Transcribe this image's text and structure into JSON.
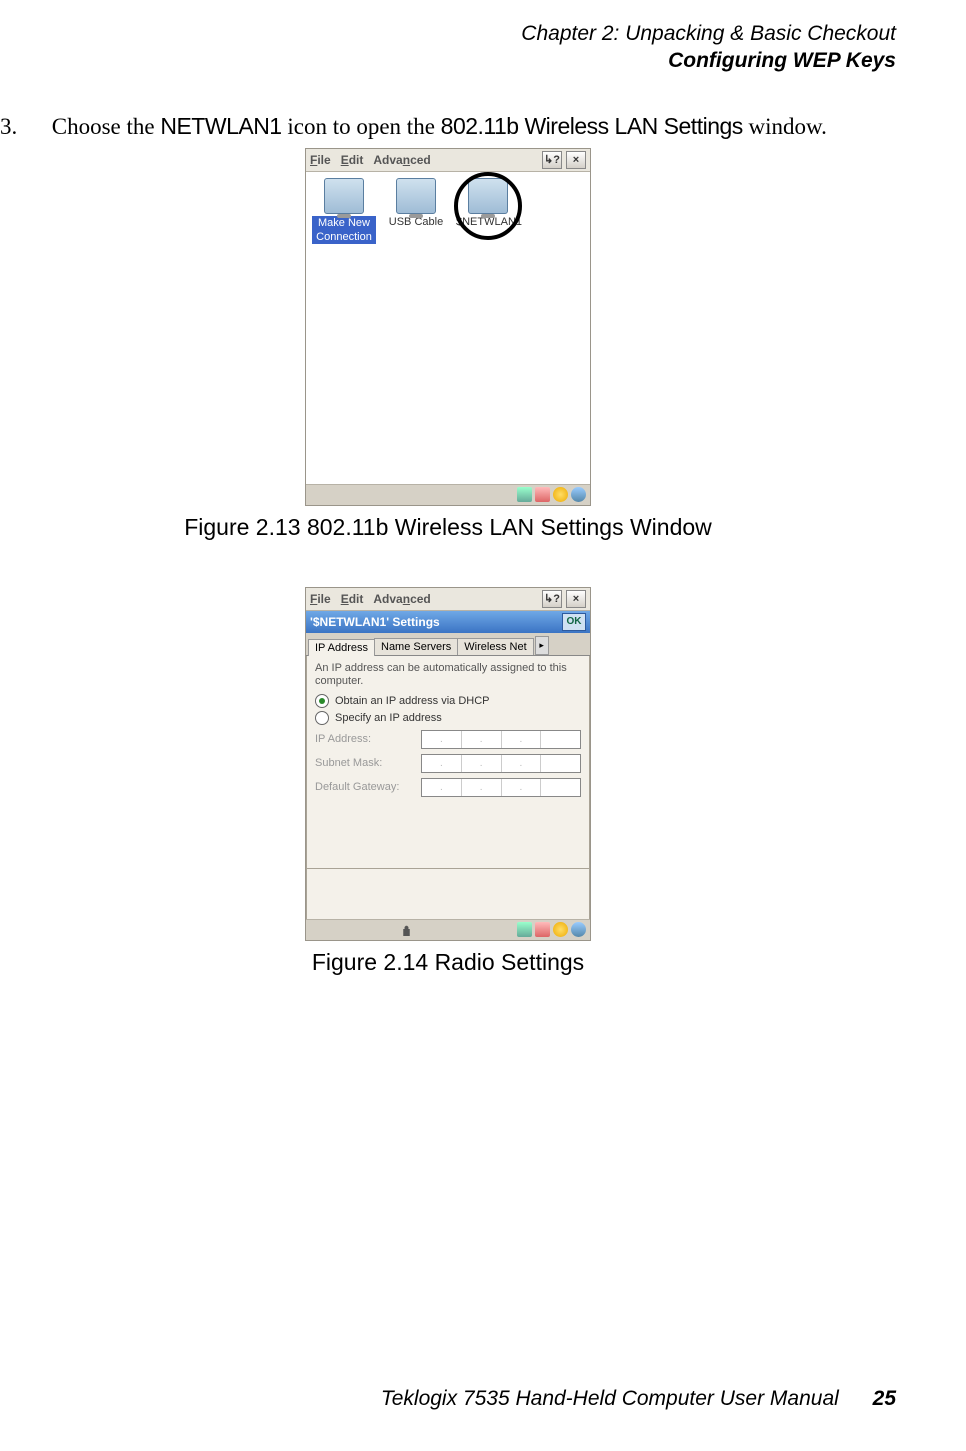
{
  "header": {
    "chapter": "Chapter  2:  Unpacking & Basic Checkout",
    "section": "Configuring WEP Keys"
  },
  "step": {
    "num": "3.",
    "pre": "Choose the ",
    "kw1": "NETWLAN1",
    "mid": " icon to open the ",
    "kw2": "802.11b Wireless LAN Settings",
    "post": " window."
  },
  "fig1": {
    "menu": {
      "file": "File",
      "file_u": "F",
      "edit": "Edit",
      "edit_u": "E",
      "advanced": "Advanced",
      "adv_u": "n",
      "help": "?",
      "close": "×"
    },
    "icons": {
      "makenew1": "Make New",
      "makenew2": "Connection",
      "usb": "USB Cable",
      "netwlan": "$NETWLAN1"
    },
    "caption": "Figure 2.13 802.11b Wireless LAN Settings Window"
  },
  "fig2": {
    "menu": {
      "file": "File",
      "file_u": "F",
      "edit": "Edit",
      "edit_u": "E",
      "advanced": "Advanced",
      "adv_u": "n",
      "help": "?",
      "close": "×"
    },
    "title": "'$NETWLAN1' Settings",
    "ok": "OK",
    "tabs": {
      "t1": "IP Address",
      "t2": "Name Servers",
      "t3": "Wireless Net"
    },
    "info": "An IP address can be automatically assigned to this computer.",
    "opt1": "Obtain an IP address via DHCP",
    "opt2": "Specify an IP address",
    "f1": "IP Address:",
    "f2": "Subnet Mask:",
    "f3": "Default Gateway:",
    "dot": ".",
    "caption": "Figure 2.14 Radio Settings"
  },
  "footer": {
    "text": "Teklogix 7535 Hand-Held Computer User Manual",
    "page": "25"
  }
}
